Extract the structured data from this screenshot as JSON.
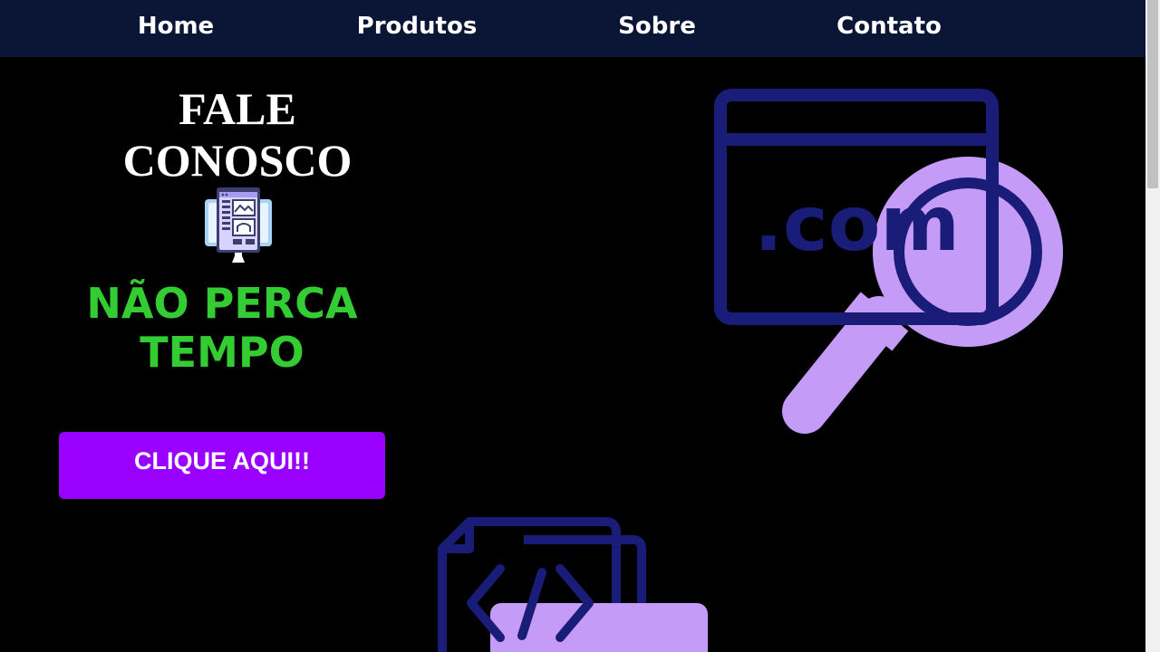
{
  "nav": {
    "items": [
      {
        "label": "Home"
      },
      {
        "label": "Produtos"
      },
      {
        "label": "Sobre"
      },
      {
        "label": "Contato"
      }
    ]
  },
  "hero": {
    "heading_line1": "FALE",
    "heading_line2": "CONOSCO",
    "tagline_line1": "NÃO PERCA",
    "tagline_line2": "TEMPO",
    "cta_label": "CLIQUE AQUI!!"
  },
  "illustrations": {
    "web_search_text": ".com",
    "web_search_icon": "web-search-magnifier",
    "code_file_icon": "code-file",
    "monitor_icon": "dashboard-monitor"
  },
  "colors": {
    "navbar_bg": "#0b1535",
    "page_bg": "#000000",
    "heading": "#ffffff",
    "tagline": "#33cc33",
    "button_bg": "#9900ff",
    "illustration_navy": "#1a1d78",
    "illustration_lavender": "#c49bf7"
  }
}
